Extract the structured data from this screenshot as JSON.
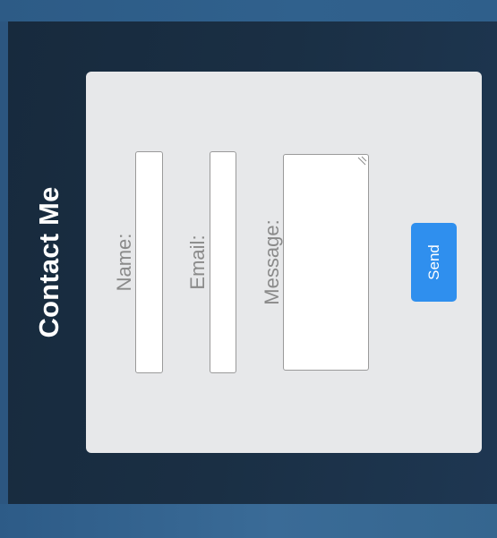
{
  "page": {
    "title": "Contact Me"
  },
  "form": {
    "name_label": "Name:",
    "email_label": "Email:",
    "message_label": "Message:",
    "name_value": "",
    "email_value": "",
    "message_value": "",
    "send_label": "Send"
  },
  "colors": {
    "page_background": "#2c5680",
    "panel_background": "#1a2f44",
    "card_background": "#e7e8ea",
    "title_text": "#ffffff",
    "label_text": "#8a8a8a",
    "button_background": "#2f8fee",
    "button_text": "#ffffff"
  },
  "icons": {
    "textarea_resize": "resize-grip-icon"
  }
}
